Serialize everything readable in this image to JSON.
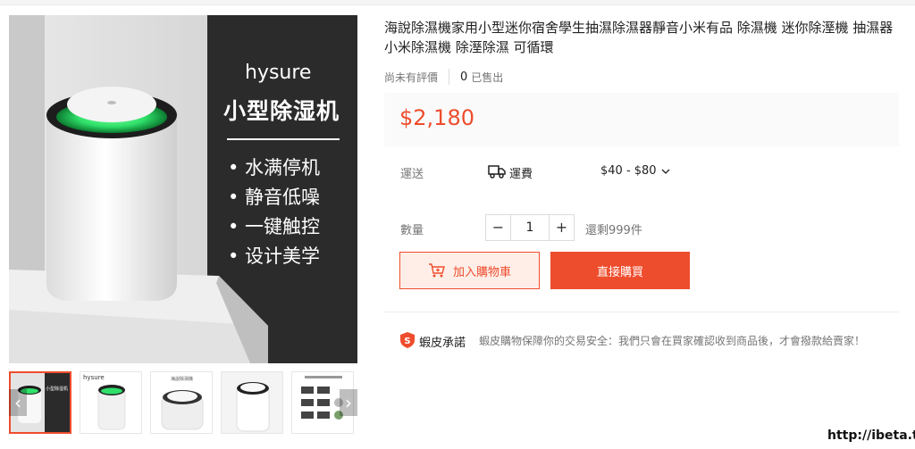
{
  "product": {
    "title": "海說除濕機家用小型迷你宿舍學生抽濕除濕器靜音小米有品 除濕機 迷你除溼機 抽濕器 小米除濕機 除溼除濕 可循環",
    "rating_text": "尚未有評價",
    "sold_count": "0",
    "sold_label": "已售出",
    "price": "$2,180"
  },
  "shipping": {
    "label": "運送",
    "fee_label": "運費",
    "fee_value": "$40 - $80"
  },
  "quantity": {
    "label": "數量",
    "minus": "−",
    "value": "1",
    "plus": "+",
    "stock": "還剩999件"
  },
  "actions": {
    "add_to_cart": "加入購物車",
    "buy_now": "直接購買"
  },
  "guarantee": {
    "title": "蝦皮承諾",
    "text": "蝦皮購物保障你的交易安全：我們只會在買家確認收到商品後，才會撥款給賣家！"
  },
  "main_image": {
    "brand": "hysure",
    "headline": "小型除湿机",
    "features": [
      "• 水满停机",
      "• 静音低噪",
      "• 一键触控",
      "• 设计美学"
    ]
  },
  "thumbnails": {
    "thumb1_headline": "小型除湿机",
    "thumb2_brand": "hysure",
    "thumb3_caption": "海說除濕機"
  },
  "watermark": "http://ibeta.tw",
  "colors": {
    "accent": "#ee4d2d",
    "accent_light": "#ffeee8",
    "device_glow": "#2fe06a"
  },
  "icons": {
    "shipping": "truck-icon",
    "cart": "cart-plus-icon",
    "guarantee": "shield-s-icon",
    "dropdown": "chevron-down-icon"
  }
}
